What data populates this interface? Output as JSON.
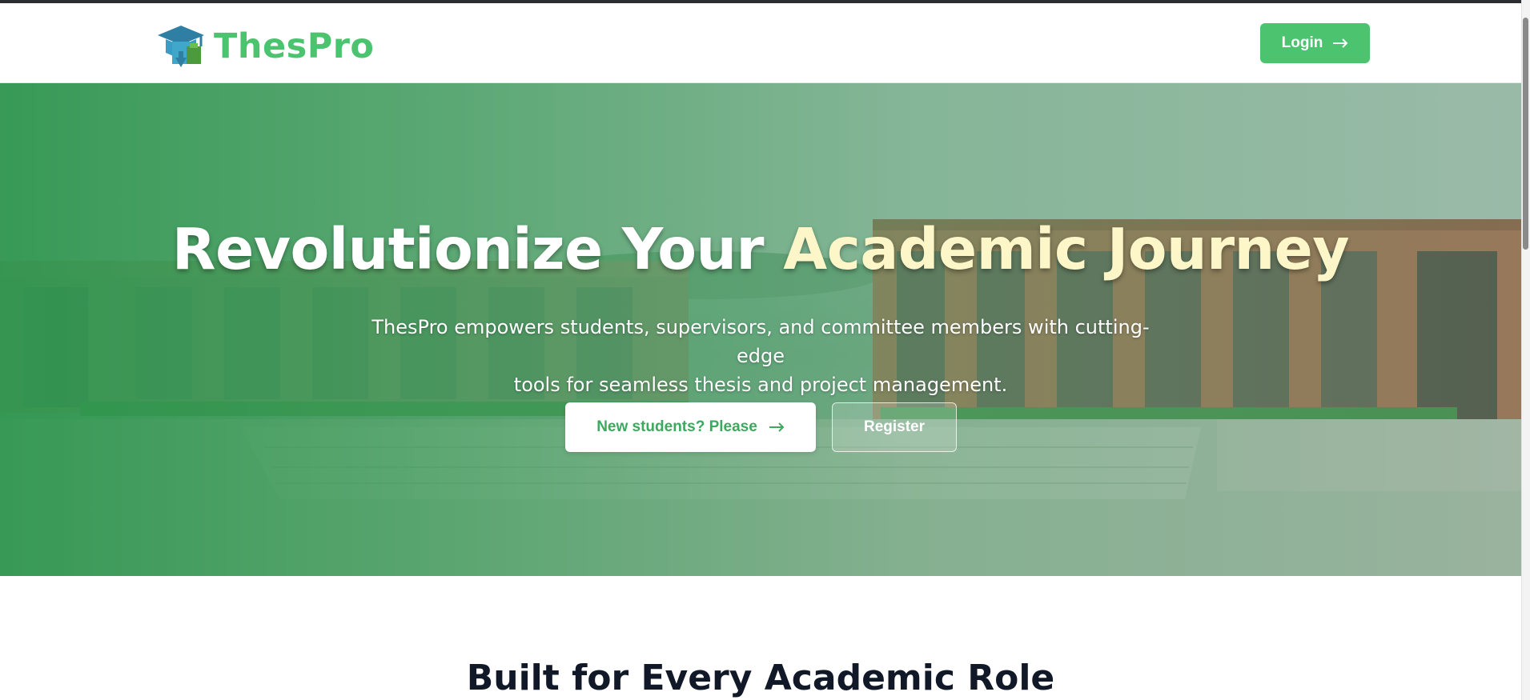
{
  "header": {
    "brand_name": "ThesPro",
    "logo_icon": "graduation-cap-icon",
    "login_label": "Login",
    "login_icon": "arrow-right-icon"
  },
  "hero": {
    "title_main": "Revolutionize Your ",
    "title_accent": "Academic Journey",
    "subtitle_line1": "ThesPro empowers students, supervisors, and committee members with cutting-edge",
    "subtitle_line2": "tools for seamless thesis and project management.",
    "new_students_label": "New students? Please",
    "new_students_icon": "arrow-right-icon",
    "register_label": "Register",
    "background_image": "campus-building-photo"
  },
  "roles": {
    "title": "Built for Every Academic Role"
  },
  "colors": {
    "brand_green": "#4cc46f",
    "hero_green": "#2e964e",
    "accent_yellow": "#fdf6c8",
    "heading_dark": "#111827"
  }
}
